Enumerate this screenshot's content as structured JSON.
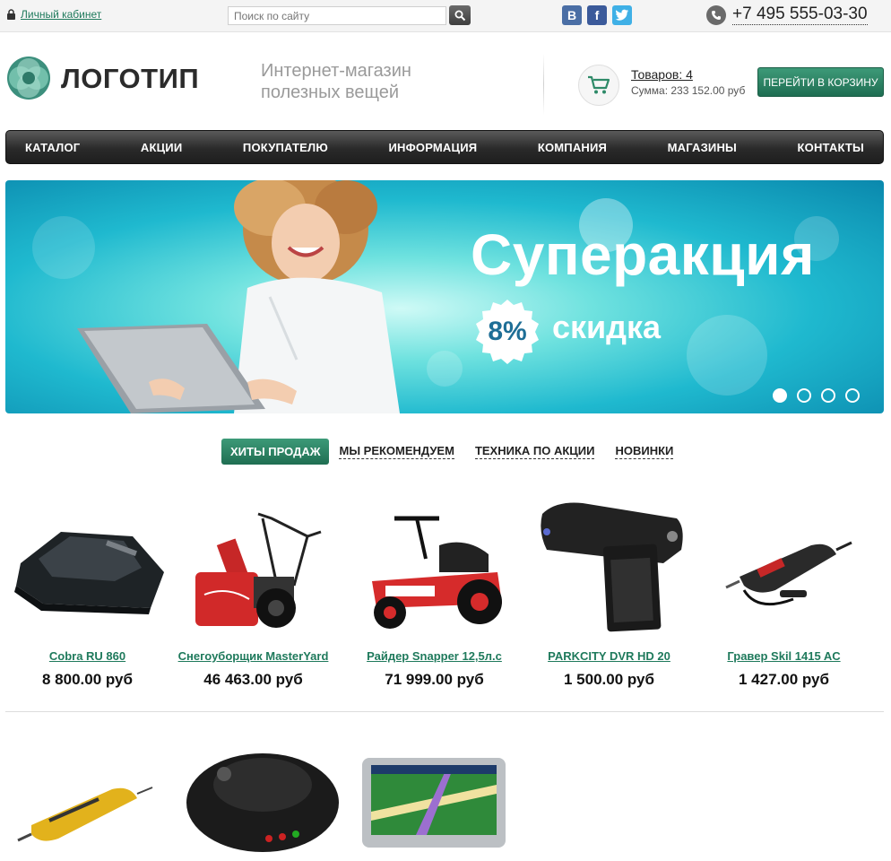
{
  "topbar": {
    "cabinet_label": "Личный кабинет",
    "search_placeholder": "Поиск по сайту",
    "social": {
      "vk": "B",
      "fb": "f"
    },
    "phone": "+7 495 555-03-30"
  },
  "header": {
    "logo_text": "ЛОГОТИП",
    "tagline_line1": "Интернет-магазин",
    "tagline_line2": "полезных вещей",
    "cart_count": "Товаров: 4",
    "cart_sum": "Сумма: 233 152.00 руб",
    "cart_button": "ПЕРЕЙТИ В КОРЗИНУ"
  },
  "nav": {
    "items": [
      {
        "label": "КАТАЛОГ"
      },
      {
        "label": "АКЦИИ"
      },
      {
        "label": "ПОКУПАТЕЛЮ"
      },
      {
        "label": "ИНФОРМАЦИЯ"
      },
      {
        "label": "КОМПАНИЯ"
      },
      {
        "label": "МАГАЗИНЫ"
      },
      {
        "label": "КОНТАКТЫ"
      }
    ]
  },
  "banner": {
    "title": "Суперакция",
    "badge": "8%",
    "discount_word": "скидка",
    "slides": 4,
    "active_slide": 1
  },
  "tabs": [
    {
      "label": "ХИТЫ ПРОДАЖ",
      "active": true
    },
    {
      "label": "МЫ РЕКОМЕНДУЕМ",
      "active": false
    },
    {
      "label": "ТЕХНИКА ПО АКЦИИ",
      "active": false
    },
    {
      "label": "НОВИНКИ",
      "active": false
    }
  ],
  "products": [
    {
      "name": "Cobra RU 860",
      "price": "8 800.00 руб"
    },
    {
      "name": "Снегоуборщик MasterYard",
      "price": "46 463.00 руб"
    },
    {
      "name": "Райдер Snapper 12,5л.с",
      "price": "71 999.00 руб"
    },
    {
      "name": "PARKCITY DVR HD 20",
      "price": "1 500.00 руб"
    },
    {
      "name": "Гравер Skil 1415 AC",
      "price": "1 427.00 руб"
    }
  ],
  "colors": {
    "accent": "#1f7a5c",
    "nav_bg": "#2a2a2a",
    "banner": "#1fb9cf"
  }
}
